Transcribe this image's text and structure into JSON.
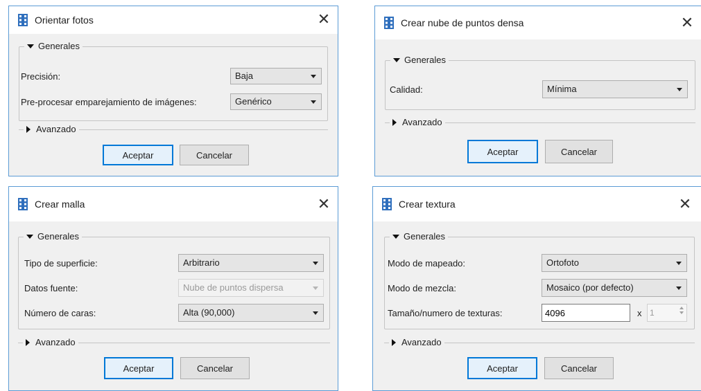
{
  "colors": {
    "accent": "#0078d7",
    "window_border": "#5b9bd5",
    "dialog_bg": "#f0f0f0",
    "app_icon": "#2f6fbd"
  },
  "dialogs": {
    "orientar": {
      "title": "Orientar fotos",
      "close_icon": "close-icon",
      "general_label": "Generales",
      "advanced_label": "Avanzado",
      "fields": [
        {
          "label": "Precisión:",
          "value": "Baja"
        },
        {
          "label": "Pre-procesar emparejamiento de imágenes:",
          "value": "Genérico"
        }
      ],
      "accept_label": "Aceptar",
      "cancel_label": "Cancelar"
    },
    "nube": {
      "title": "Crear nube de puntos densa",
      "close_icon": "close-icon",
      "general_label": "Generales",
      "advanced_label": "Avanzado",
      "fields": [
        {
          "label": "Calidad:",
          "value": "Mínima"
        }
      ],
      "accept_label": "Aceptar",
      "cancel_label": "Cancelar"
    },
    "malla": {
      "title": "Crear malla",
      "close_icon": "close-icon",
      "general_label": "Generales",
      "advanced_label": "Avanzado",
      "fields": [
        {
          "label": "Tipo de superficie:",
          "value": "Arbitrario",
          "disabled": false
        },
        {
          "label": "Datos fuente:",
          "value": "Nube de puntos dispersa",
          "disabled": true
        },
        {
          "label": "Número de caras:",
          "value": "Alta (90,000)",
          "disabled": false
        }
      ],
      "accept_label": "Aceptar",
      "cancel_label": "Cancelar"
    },
    "textura": {
      "title": "Crear textura",
      "close_icon": "close-icon",
      "general_label": "Generales",
      "advanced_label": "Avanzado",
      "fields": [
        {
          "label": "Modo de mapeado:",
          "value": "Ortofoto"
        },
        {
          "label": "Modo de mezcla:",
          "value": "Mosaico (por defecto)"
        }
      ],
      "texture_label": "Tamaño/numero de texturas:",
      "texture_size": "4096",
      "times_symbol": "x",
      "texture_count": "1",
      "accept_label": "Aceptar",
      "cancel_label": "Cancelar"
    }
  }
}
